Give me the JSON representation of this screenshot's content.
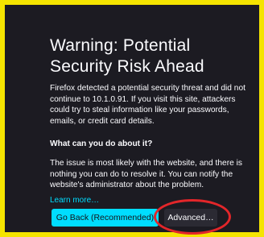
{
  "warning": {
    "title": "Warning: Potential Security Risk Ahead",
    "description": "Firefox detected a potential security threat and did not continue to 10.1.0.91. If you visit this site, attackers could try to steal information like your passwords, emails, or credit card details.",
    "subheading": "What can you do about it?",
    "advice": "The issue is most likely with the website, and there is nothing you can do to resolve it. You can notify the website's administrator about the problem.",
    "learn_more": "Learn more…"
  },
  "buttons": {
    "go_back": "Go Back (Recommended)",
    "advanced": "Advanced…"
  },
  "colors": {
    "frame": "#f5e400",
    "background": "#1c1b22",
    "accent": "#00ddff",
    "annotation": "#e3262a"
  }
}
